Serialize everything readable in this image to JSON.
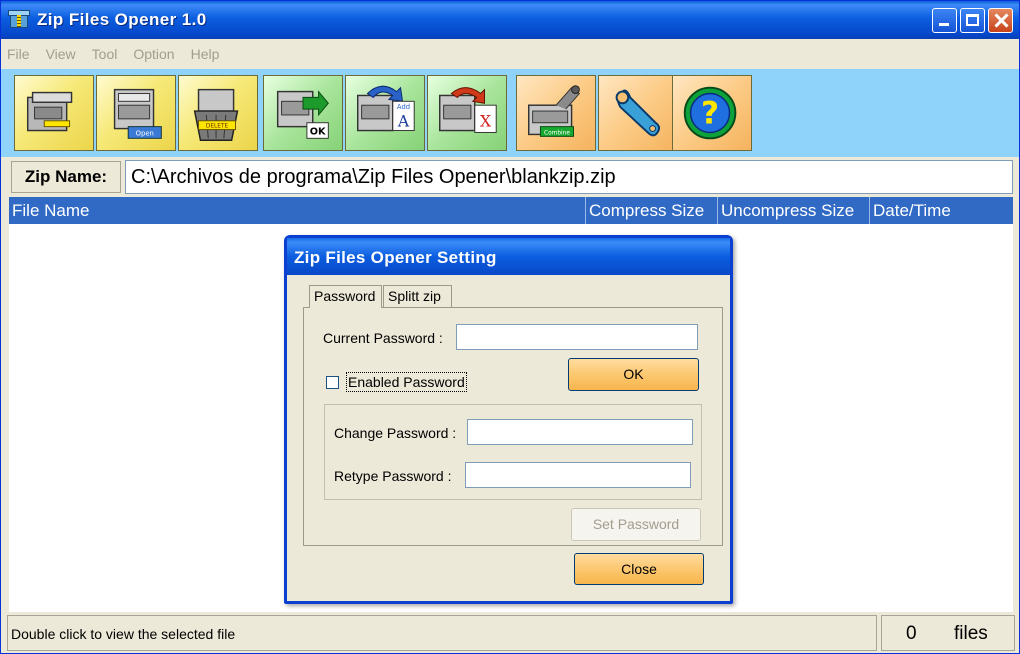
{
  "window": {
    "title": "Zip Files Opener 1.0"
  },
  "menu": [
    "File",
    "View",
    "Tool",
    "Option",
    "Help"
  ],
  "toolbar": {
    "buttons": [
      {
        "icon": "new-zip-icon",
        "color": "yellow"
      },
      {
        "icon": "open-zip-icon",
        "color": "yellow",
        "caption": "Open"
      },
      {
        "icon": "delete-zip-icon",
        "color": "yellow",
        "caption": "DELETE"
      },
      {
        "icon": "extract-ok-icon",
        "color": "green",
        "caption": "OK"
      },
      {
        "icon": "add-files-icon",
        "color": "green",
        "caption": "Add",
        "letter": "A"
      },
      {
        "icon": "remove-files-icon",
        "color": "green",
        "letter": "X"
      },
      {
        "icon": "combine-icon",
        "color": "orange",
        "caption": "Combine"
      },
      {
        "icon": "wrench-icon",
        "color": "orange"
      },
      {
        "icon": "help-icon",
        "color": "orange",
        "letter": "?"
      }
    ]
  },
  "zipname": {
    "label": "Zip Name:",
    "value": "C:\\Archivos de programa\\Zip Files Opener\\blankzip.zip"
  },
  "list": {
    "columns": [
      "File Name",
      "Compress Size",
      "Uncompress Size",
      "Date/Time"
    ]
  },
  "status": {
    "message": "Double click to view the selected file",
    "count": "0",
    "unit": "files"
  },
  "dialog": {
    "title": "Zip Files Opener Setting",
    "tabs": [
      "Password",
      "Splitt zip"
    ],
    "current_password_label": "Current Password :",
    "ok_label": "OK",
    "enabled_password_label": "Enabled Password",
    "change_password_label": "Change Password :",
    "retype_password_label": "Retype Password :",
    "set_password_label": "Set Password",
    "close_label": "Close"
  },
  "colors": {
    "titlebar": "#0c5ee0",
    "toolbar_bg": "#8fd3fb",
    "list_header": "#316ac5",
    "button_orange": "#fcc870"
  }
}
